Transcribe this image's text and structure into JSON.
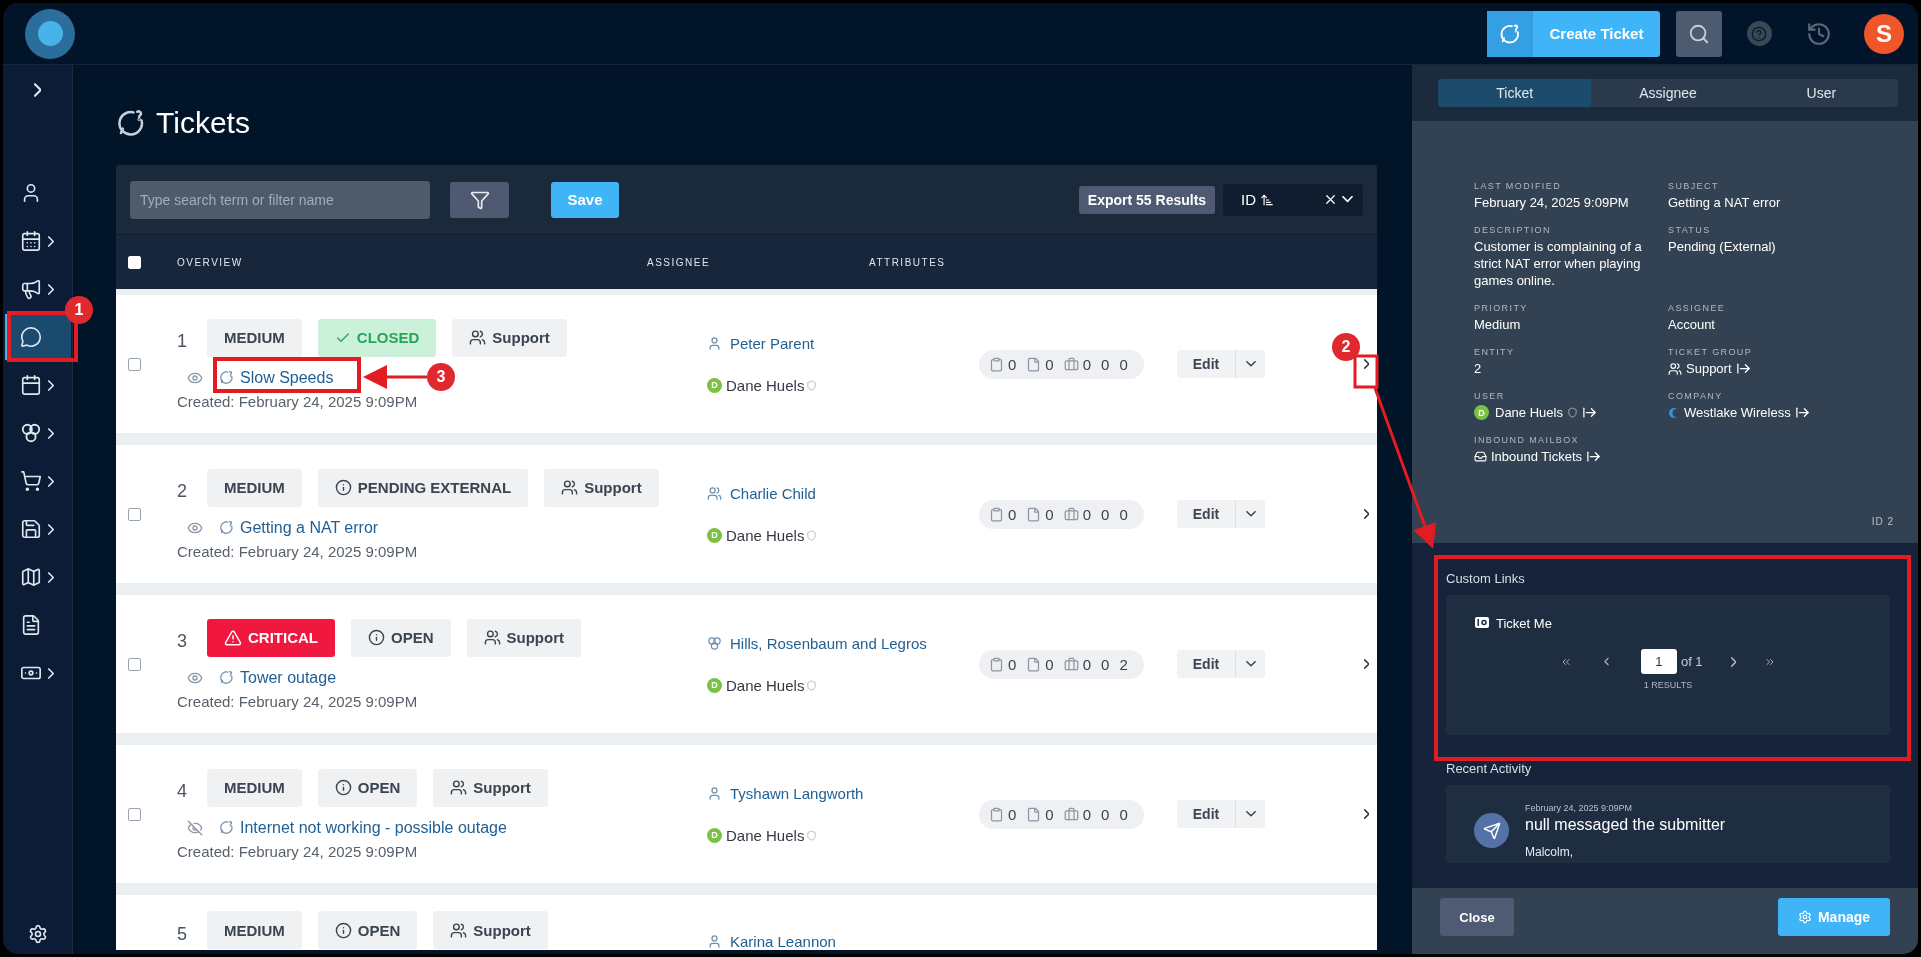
{
  "topbar": {
    "create_label": "Create Ticket",
    "avatar_letter": "S"
  },
  "sidebar": {
    "items": [
      {
        "kind": "user",
        "selected": false,
        "expandable": false
      },
      {
        "kind": "schedule",
        "selected": false,
        "expandable": true
      },
      {
        "kind": "megaphone",
        "selected": false,
        "expandable": true
      },
      {
        "kind": "chat",
        "selected": true,
        "expandable": false
      },
      {
        "kind": "calendar",
        "selected": false,
        "expandable": true
      },
      {
        "kind": "cluster",
        "selected": false,
        "expandable": true
      },
      {
        "kind": "cart",
        "selected": false,
        "expandable": true
      },
      {
        "kind": "save",
        "selected": false,
        "expandable": true
      },
      {
        "kind": "map",
        "selected": false,
        "expandable": true
      },
      {
        "kind": "report",
        "selected": false,
        "expandable": false
      },
      {
        "kind": "money",
        "selected": false,
        "expandable": true
      }
    ]
  },
  "page": {
    "title": "Tickets"
  },
  "toolbar": {
    "search": {
      "placeholder": "Type search term or filter name"
    },
    "save": "Save",
    "export": "Export 55 Results",
    "sort": "ID"
  },
  "table": {
    "select_all": {
      "checked": false
    },
    "columns": [
      "OVERVIEW",
      "ASSIGNEE",
      "ATTRIBUTES"
    ],
    "rows": [
      {
        "number": "1",
        "checked": false,
        "priority": {
          "kind": "medium",
          "label": "MEDIUM"
        },
        "status": {
          "kind": "closed",
          "label": "CLOSED"
        },
        "group": "Support",
        "watched": true,
        "title": "Slow Speeds",
        "created": "Created: February 24, 2025 9:09PM",
        "assignee": {
          "kind": "user",
          "name": "Peter Parent"
        },
        "reporter": {
          "initial": "D",
          "name": "Dane Huels"
        },
        "attributes": [
          "0",
          "0",
          "0",
          "0",
          "0"
        ],
        "edit": "Edit"
      },
      {
        "number": "2",
        "checked": false,
        "priority": {
          "kind": "medium",
          "label": "MEDIUM"
        },
        "status": {
          "kind": "info",
          "label": "PENDING EXTERNAL"
        },
        "group": "Support",
        "watched": true,
        "title": "Getting a NAT error",
        "created": "Created: February 24, 2025 9:09PM",
        "assignee": {
          "kind": "group",
          "name": "Charlie Child"
        },
        "reporter": {
          "initial": "D",
          "name": "Dane Huels"
        },
        "attributes": [
          "0",
          "0",
          "0",
          "0",
          "0"
        ],
        "edit": "Edit"
      },
      {
        "number": "3",
        "checked": false,
        "priority": {
          "kind": "critical",
          "label": "CRITICAL"
        },
        "status": {
          "kind": "info",
          "label": "OPEN"
        },
        "group": "Support",
        "watched": true,
        "title": "Tower outage",
        "created": "Created: February 24, 2025 9:09PM",
        "assignee": {
          "kind": "company",
          "name": "Hills, Rosenbaum and Legros"
        },
        "reporter": {
          "initial": "D",
          "name": "Dane Huels"
        },
        "attributes": [
          "0",
          "0",
          "0",
          "0",
          "2"
        ],
        "edit": "Edit"
      },
      {
        "number": "4",
        "checked": false,
        "priority": {
          "kind": "medium",
          "label": "MEDIUM"
        },
        "status": {
          "kind": "info",
          "label": "OPEN"
        },
        "group": "Support",
        "watched": false,
        "title": "Internet not working - possible outage",
        "created": "Created: February 24, 2025 9:09PM",
        "assignee": {
          "kind": "user",
          "name": "Tyshawn Langworth"
        },
        "reporter": {
          "initial": "D",
          "name": "Dane Huels"
        },
        "attributes": [
          "0",
          "0",
          "0",
          "0",
          "0"
        ],
        "edit": "Edit"
      },
      {
        "number": "5",
        "priority": {
          "kind": "medium",
          "label": "MEDIUM"
        },
        "status": {
          "kind": "info",
          "label": "OPEN"
        },
        "group": "Support",
        "assignee": {
          "kind": "user",
          "name": "Karina Leannon"
        }
      }
    ]
  },
  "side_panel": {
    "tabs": [
      {
        "label": "Ticket",
        "selected": true
      },
      {
        "label": "Assignee",
        "selected": false
      },
      {
        "label": "User",
        "selected": false
      }
    ],
    "fields": [
      {
        "kind": "text",
        "label": "LAST MODIFIED",
        "value": "February 24, 2025 9:09PM"
      },
      {
        "kind": "text",
        "label": "SUBJECT",
        "value": "Getting a NAT error"
      },
      {
        "kind": "text",
        "label": "DESCRIPTION",
        "value": "Customer is complaining of a strict NAT error when playing games online."
      },
      {
        "kind": "text",
        "label": "STATUS",
        "value": "Pending (External)"
      },
      {
        "kind": "text",
        "label": "PRIORITY",
        "value": "Medium"
      },
      {
        "kind": "text",
        "label": "ASSIGNEE",
        "value": "Account"
      },
      {
        "kind": "text",
        "label": "ENTITY",
        "value": "2"
      },
      {
        "kind": "group",
        "label": "TICKET GROUP",
        "value": "Support"
      },
      {
        "kind": "user",
        "label": "USER",
        "value": "Dane Huels",
        "initial": "D"
      },
      {
        "kind": "company",
        "label": "COMPANY",
        "value": "Westlake Wireless"
      },
      {
        "kind": "mailbox",
        "label": "INBOUND MAILBOX",
        "value": "Inbound Tickets"
      }
    ],
    "id": "ID 2",
    "custom_links": {
      "title": "Custom Links",
      "items": [
        {
          "label": "Ticket Me"
        }
      ],
      "page": "1",
      "of": "of 1",
      "results": "1 RESULTS"
    },
    "recent_activity": {
      "title": "Recent Activity",
      "items": [
        {
          "time": "February 24, 2025 9:09PM",
          "text": "null messaged the submitter",
          "body": "Malcolm,"
        }
      ]
    },
    "close": "Close",
    "manage": "Manage"
  },
  "annotations": [
    {
      "label": "1"
    },
    {
      "label": "2"
    },
    {
      "label": "3"
    }
  ]
}
